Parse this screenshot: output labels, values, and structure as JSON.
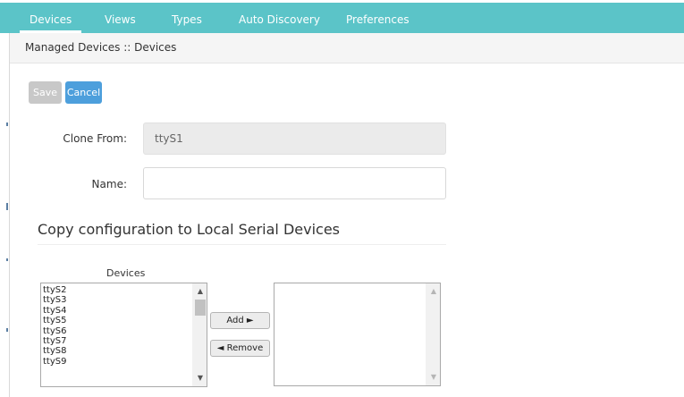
{
  "nav": {
    "tabs": [
      {
        "label": "Devices",
        "active": true
      },
      {
        "label": "Views",
        "active": false
      },
      {
        "label": "Types",
        "active": false
      },
      {
        "label": "Auto Discovery",
        "active": false
      },
      {
        "label": "Preferences",
        "active": false
      }
    ]
  },
  "breadcrumb": "Managed Devices :: Devices",
  "actions": {
    "save_label": "Save",
    "cancel_label": "Cancel"
  },
  "form": {
    "clone_from_label": "Clone From:",
    "clone_from_value": "ttyS1",
    "name_label": "Name:",
    "name_value": ""
  },
  "section": {
    "title": "Copy configuration to Local Serial Devices"
  },
  "devices_list": {
    "label": "Devices",
    "items": [
      "ttyS2",
      "ttyS3",
      "ttyS4",
      "ttyS5",
      "ttyS6",
      "ttyS7",
      "ttyS8",
      "ttyS9"
    ]
  },
  "selected_list": {
    "items": []
  },
  "transfer": {
    "add_label": "Add ►",
    "remove_label": "◄ Remove"
  },
  "colors": {
    "nav_bg": "#5bc4c8",
    "primary_button": "#4d9fdc",
    "disabled_button": "#c8c8c8"
  }
}
